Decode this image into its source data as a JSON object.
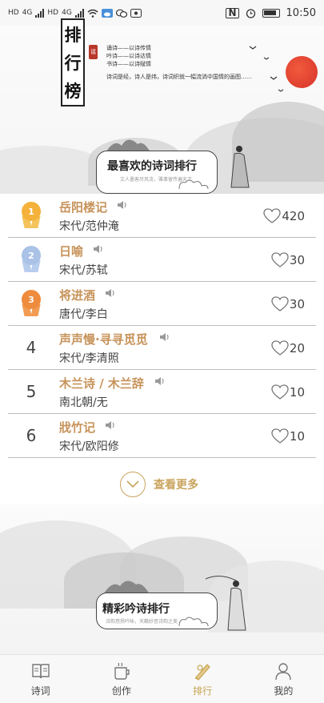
{
  "status_bar": {
    "left_labels": [
      "HD",
      "4G",
      "HD",
      "4G"
    ],
    "time": "10:50"
  },
  "hero": {
    "seal_chars": [
      "排",
      "行",
      "榜"
    ],
    "red_seal": "谣",
    "lines": [
      "诵诗——以诗传情",
      "吟诗——以诗达情",
      "书诗——以诗赋情"
    ],
    "description": "诗词是经，诗人是纬，诗词织就一幅流淌中国情的画图……"
  },
  "section_favorite": {
    "title": "最喜欢的诗词排行",
    "subtitle": "文人墨客尽风流，雅事留传遍天下"
  },
  "rankings": [
    {
      "rank": "1",
      "medal": "gold",
      "title": "岳阳楼记",
      "dynasty_author": "宋代/范仲淹",
      "likes": "420"
    },
    {
      "rank": "2",
      "medal": "silver",
      "title": "日喻",
      "dynasty_author": "宋代/苏轼",
      "likes": "30"
    },
    {
      "rank": "3",
      "medal": "bronze",
      "title": "将进酒",
      "dynasty_author": "唐代/李白",
      "likes": "30"
    },
    {
      "rank": "4",
      "medal": "",
      "title": "声声慢·寻寻觅觅",
      "dynasty_author": "宋代/李清照",
      "likes": "20"
    },
    {
      "rank": "5",
      "medal": "",
      "title": "木兰诗 / 木兰辞",
      "dynasty_author": "南北朝/无",
      "likes": "10"
    },
    {
      "rank": "6",
      "medal": "",
      "title": "戕竹记",
      "dynasty_author": "宋代/欧阳修",
      "likes": "10"
    }
  ],
  "see_more": "查看更多",
  "section_recital": {
    "title": "精彩吟诗排行",
    "subtitle": "诗韵悠扬吟咏，天籁妙音诗韵之美"
  },
  "tabs": [
    {
      "label": "诗词",
      "icon": "book-icon",
      "active": false
    },
    {
      "label": "创作",
      "icon": "mug-icon",
      "active": false
    },
    {
      "label": "排行",
      "icon": "ranking-icon",
      "active": true
    },
    {
      "label": "我的",
      "icon": "person-icon",
      "active": false
    }
  ],
  "colors": {
    "accent": "#c7a34f",
    "title_gold": "#c7935a",
    "sun_red": "#d7332a"
  }
}
